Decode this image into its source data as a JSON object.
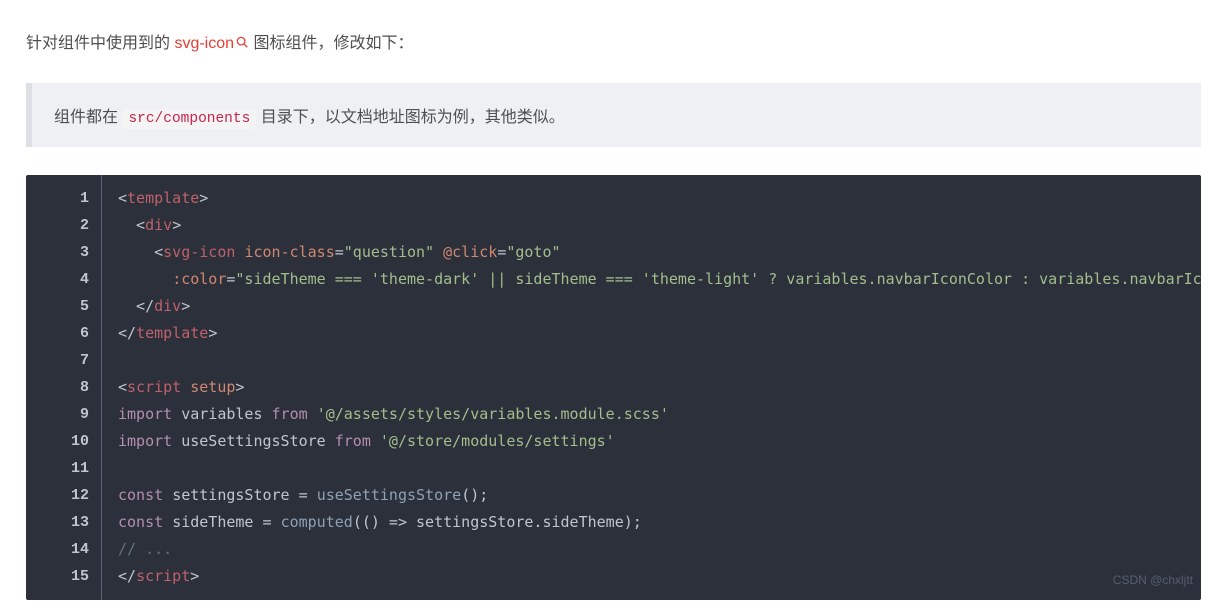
{
  "intro": {
    "before_link": "针对组件中使用到的 ",
    "link_text": "svg-icon",
    "after_link": " 图标组件，修改如下：",
    "search_icon_name": "search-icon"
  },
  "note": {
    "before_code": "组件都在 ",
    "code_text": "src/components",
    "after_code": " 目录下，以文档地址图标为例，其他类似。"
  },
  "code": {
    "line_count": 15,
    "watermark": "CSDN @chxljtt",
    "lines": {
      "l1": [
        [
          "p",
          "<"
        ],
        [
          "t",
          "template"
        ],
        [
          "p",
          ">"
        ]
      ],
      "l2": [
        [
          "p",
          "  <"
        ],
        [
          "t",
          "div"
        ],
        [
          "p",
          ">"
        ]
      ],
      "l3": [
        [
          "p",
          "    <"
        ],
        [
          "t",
          "svg-icon"
        ],
        [
          "p",
          " "
        ],
        [
          "a",
          "icon-class"
        ],
        [
          "p",
          "="
        ],
        [
          "s",
          "\"question\""
        ],
        [
          "p",
          " "
        ],
        [
          "a",
          "@click"
        ],
        [
          "p",
          "="
        ],
        [
          "s",
          "\"goto\""
        ]
      ],
      "l4": [
        [
          "p",
          "      "
        ],
        [
          "a",
          ":color"
        ],
        [
          "p",
          "="
        ],
        [
          "s",
          "\"sideTheme === 'theme-dark' || sideTheme === 'theme-light' ? variables.navbarIconColor : variables.navbarIconColor\""
        ]
      ],
      "l5": [
        [
          "p",
          "  </"
        ],
        [
          "t",
          "div"
        ],
        [
          "p",
          ">"
        ]
      ],
      "l6": [
        [
          "p",
          "</"
        ],
        [
          "t",
          "template"
        ],
        [
          "p",
          ">"
        ]
      ],
      "l7": [
        [
          "p",
          ""
        ]
      ],
      "l8": [
        [
          "p",
          "<"
        ],
        [
          "t",
          "script"
        ],
        [
          "p",
          " "
        ],
        [
          "a",
          "setup"
        ],
        [
          "p",
          ">"
        ]
      ],
      "l9": [
        [
          "k",
          "import"
        ],
        [
          "p",
          " "
        ],
        [
          "v",
          "variables"
        ],
        [
          "p",
          " "
        ],
        [
          "k",
          "from"
        ],
        [
          "p",
          " "
        ],
        [
          "s",
          "'@/assets/styles/variables.module.scss'"
        ]
      ],
      "l10": [
        [
          "k",
          "import"
        ],
        [
          "p",
          " "
        ],
        [
          "v",
          "useSettingsStore"
        ],
        [
          "p",
          " "
        ],
        [
          "k",
          "from"
        ],
        [
          "p",
          " "
        ],
        [
          "s",
          "'@/store/modules/settings'"
        ]
      ],
      "l11": [
        [
          "p",
          ""
        ]
      ],
      "l12": [
        [
          "k",
          "const"
        ],
        [
          "p",
          " "
        ],
        [
          "v",
          "settingsStore"
        ],
        [
          "p",
          " = "
        ],
        [
          "f",
          "useSettingsStore"
        ],
        [
          "p",
          "();"
        ]
      ],
      "l13": [
        [
          "k",
          "const"
        ],
        [
          "p",
          " "
        ],
        [
          "v",
          "sideTheme"
        ],
        [
          "p",
          " = "
        ],
        [
          "f",
          "computed"
        ],
        [
          "p",
          "(() => settingsStore.sideTheme);"
        ]
      ],
      "l14": [
        [
          "c",
          "// ..."
        ]
      ],
      "l15": [
        [
          "p",
          "</"
        ],
        [
          "t",
          "script"
        ],
        [
          "p",
          ">"
        ]
      ]
    }
  }
}
